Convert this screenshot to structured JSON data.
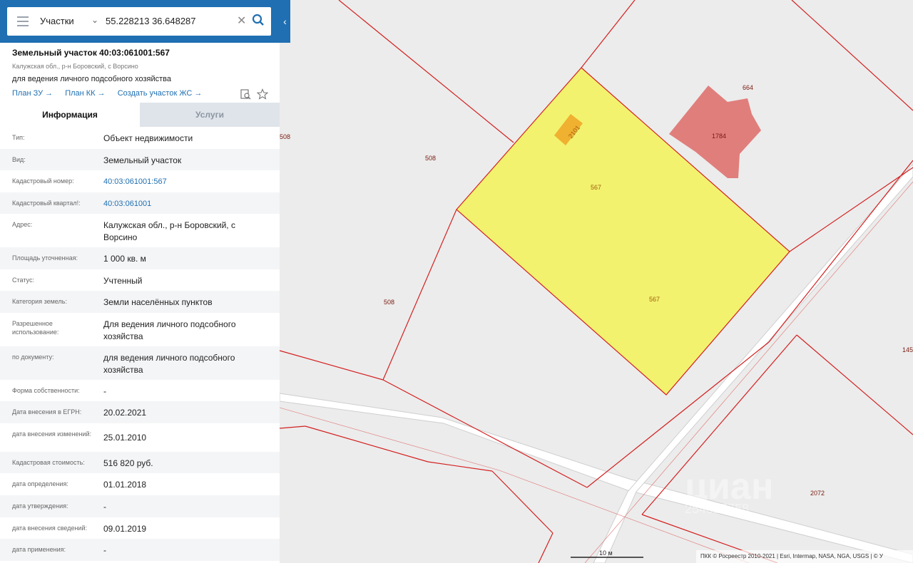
{
  "search": {
    "layer": "Участки",
    "query": "55.228213 36.648287"
  },
  "object": {
    "title": "Земельный участок 40:03:061001:567",
    "address_short": "Калужская обл., р-н Боровский, с Ворсино",
    "purpose": "для ведения личного подсобного хозяйства"
  },
  "links": [
    "План ЗУ →",
    "План КК →",
    "Создать участок ЖС →"
  ],
  "tabs": [
    "Информация",
    "Услуги"
  ],
  "rows": [
    {
      "label": "Тип:",
      "value": "Объект недвижимости"
    },
    {
      "label": "Вид:",
      "value": "Земельный участок"
    },
    {
      "label": "Кадастровый номер:",
      "value": "40:03:061001:567"
    },
    {
      "label": "Кадастровый квартал!:",
      "value": "40:03:061001"
    },
    {
      "label": "Адрес:",
      "value": "Калужская обл., р-н Боровский, с Ворсино"
    },
    {
      "label": "Площадь уточненная:",
      "value": "1 000 кв. м"
    },
    {
      "label": "Статус:",
      "value": "Учтенный"
    },
    {
      "label": "Категория земель:",
      "value": "Земли населённых пунктов"
    },
    {
      "label": "Разрешенное использование:",
      "value": "Для ведения личного подсобного хозяйства"
    },
    {
      "label": "по документу:",
      "value": "для ведения личного подсобного хозяйства"
    },
    {
      "label": "Форма собственности:",
      "value": "-"
    },
    {
      "label": "Дата внесения в ЕГРН:",
      "value": "20.02.2021"
    },
    {
      "label": "дата внесения изменений:",
      "value": "25.01.2010"
    },
    {
      "label": "Кадастровая стоимость:",
      "value": "516 820 руб."
    },
    {
      "label": "дата определения:",
      "value": "01.01.2018"
    },
    {
      "label": "дата утверждения:",
      "value": "-"
    },
    {
      "label": "дата внесения сведений:",
      "value": "09.01.2019"
    },
    {
      "label": "дата применения:",
      "value": "-"
    }
  ],
  "map": {
    "parcel_labels": [
      "664",
      "508",
      "508",
      "508",
      "567",
      "567",
      "2101",
      "1784",
      "145",
      "2072"
    ],
    "watermark": "циан",
    "watermark_id": "254827758",
    "scale": "10 м",
    "attribution": "ПКК © Росреестр 2010-2021 | Esri, Intermap, NASA, NGA, USGS | © У",
    "colors": {
      "parcel_border": "#d42020",
      "selected_fill": "#f2f26e",
      "building_fill": "#e07e7c",
      "small_building_fill": "#f0b030",
      "road": "#ffffff",
      "label": "#7a1a10"
    }
  }
}
